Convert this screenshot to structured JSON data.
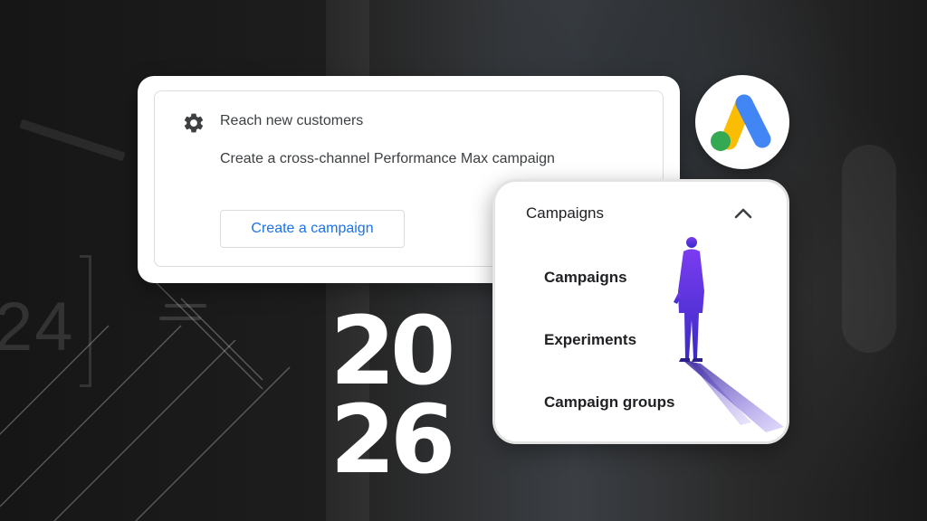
{
  "promo_card": {
    "icon": "gear-icon",
    "title": "Reach new customers",
    "subtitle": "Create a cross-channel Performance Max campaign",
    "button_label": "Create a campaign"
  },
  "logo": {
    "name": "google-ads-logo",
    "colors": {
      "blue": "#4285F4",
      "yellow": "#FBBC04",
      "green": "#34A853"
    }
  },
  "campaigns_menu": {
    "header": "Campaigns",
    "toggle_icon": "chevron-up-icon",
    "items": [
      {
        "label": "Campaigns"
      },
      {
        "label": "Experiments"
      },
      {
        "label": "Campaign groups"
      }
    ]
  },
  "year": {
    "top": "20",
    "bottom": "26"
  },
  "background": {
    "digits": "24",
    "dashes": "= ="
  },
  "colors": {
    "accent_blue": "#1a73e8",
    "text_primary": "#202124",
    "text_secondary": "#3c4043",
    "figure_purple": "#5b2fd6"
  }
}
